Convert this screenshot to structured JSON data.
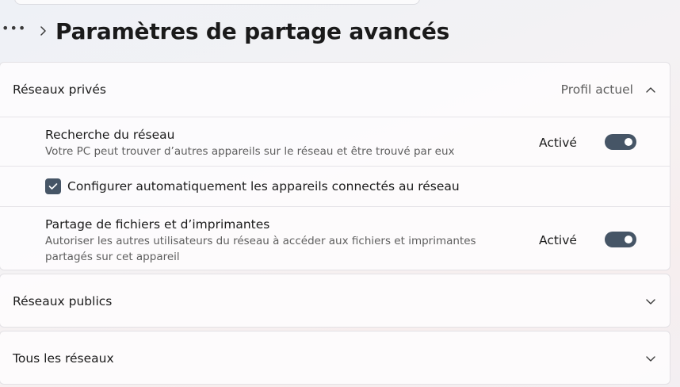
{
  "header": {
    "more_icon": "more-horizontal-icon",
    "separator_icon": "chevron-right-icon",
    "title": "Paramètres de partage avancés"
  },
  "private_networks": {
    "title": "Réseaux privés",
    "status": "Profil actuel",
    "expanded": true,
    "network_discovery": {
      "title": "Recherche du réseau",
      "description": "Votre PC peut trouver d’autres appareils sur le réseau et être trouvé par eux",
      "state": "Activé",
      "on": true
    },
    "auto_setup": {
      "label": "Configurer automatiquement les appareils connectés au réseau",
      "checked": true
    },
    "file_sharing": {
      "title": "Partage de fichiers et d’imprimantes",
      "description": "Autoriser les autres utilisateurs du réseau à accéder aux fichiers et imprimantes partagés sur cet appareil",
      "state": "Activé",
      "on": true
    }
  },
  "public_networks": {
    "title": "Réseaux publics",
    "expanded": false
  },
  "all_networks": {
    "title": "Tous les réseaux",
    "expanded": false
  },
  "colors": {
    "accent": "#465566",
    "text_primary": "#1b1b1b",
    "text_secondary": "#5e5e5e",
    "card_border": "#e3e1e5"
  }
}
